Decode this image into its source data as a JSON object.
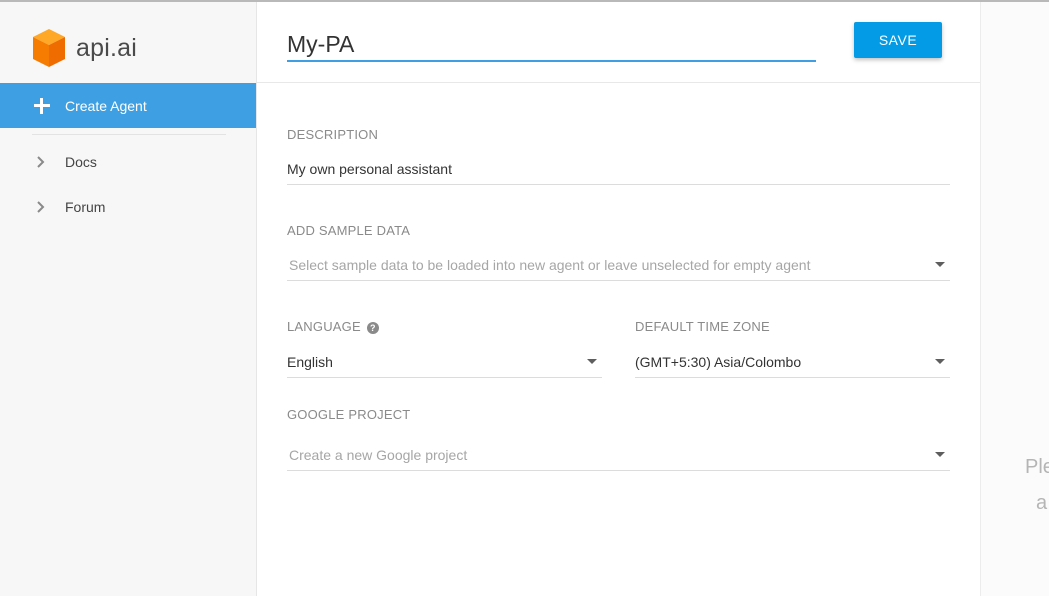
{
  "sidebar": {
    "logo_text": "api.ai",
    "create_agent_label": "Create Agent",
    "links": [
      {
        "label": "Docs"
      },
      {
        "label": "Forum"
      }
    ]
  },
  "header": {
    "agent_name": "My-PA",
    "save_label": "SAVE"
  },
  "form": {
    "description": {
      "label": "DESCRIPTION",
      "value": "My own personal assistant"
    },
    "sample_data": {
      "label": "ADD SAMPLE DATA",
      "placeholder": "Select sample data to be loaded into new agent or leave unselected for empty agent"
    },
    "language": {
      "label": "LANGUAGE",
      "value": "English"
    },
    "timezone": {
      "label": "DEFAULT TIME ZONE",
      "value": "(GMT+5:30) Asia/Colombo"
    },
    "google_project": {
      "label": "GOOGLE PROJECT",
      "placeholder": "Create a new Google project"
    }
  },
  "right_panel": {
    "line1": "Ple",
    "line2": "a"
  },
  "colors": {
    "accent": "#3ea0e2",
    "save_button": "#039be5",
    "logo_orange": "#f57c00"
  }
}
